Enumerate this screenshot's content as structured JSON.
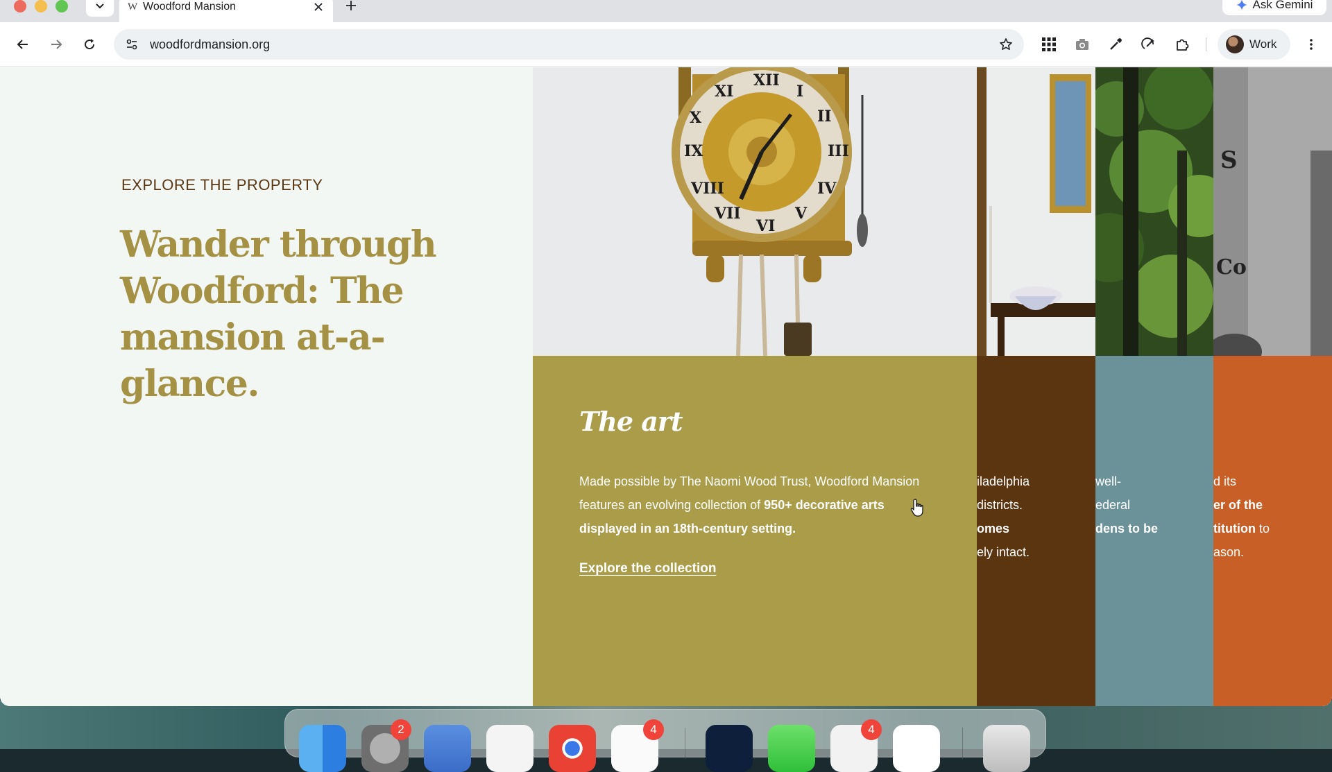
{
  "browser": {
    "tab_title": "Woodford Mansion",
    "tab_favicon": "W",
    "url": "woodfordmansion.org",
    "ask_gemini_label": "Ask Gemini",
    "profile_label": "Work"
  },
  "intro": {
    "eyebrow": "EXPLORE THE PROPERTY",
    "headline": "Wander through Woodford: The mansion at-a-glance."
  },
  "panels": {
    "art": {
      "title": "The art",
      "text_plain": "Made possible by The Naomi Wood Trust, Woodford Mansion features an evolving collection of ",
      "text_bold": "950+ decorative arts displayed in an 18th-century setting.",
      "link_label": "Explore the collection",
      "body_color": "#aa9c48"
    },
    "panel_b": {
      "lines": [
        "iladelphia",
        " districts.",
        "omes",
        "ely intact."
      ],
      "body_color": "#5b3510"
    },
    "panel_c": {
      "lines": [
        "well-",
        "ederal",
        "dens to be",
        ""
      ],
      "body_color": "#6b9199"
    },
    "panel_d": {
      "lines": [
        "d its",
        "er of the",
        "titution to",
        "ason."
      ],
      "body_color": "#c75f26"
    }
  },
  "dock": {
    "badges": {
      "system_settings": "2",
      "calendar": "4",
      "app_store": "4"
    }
  }
}
